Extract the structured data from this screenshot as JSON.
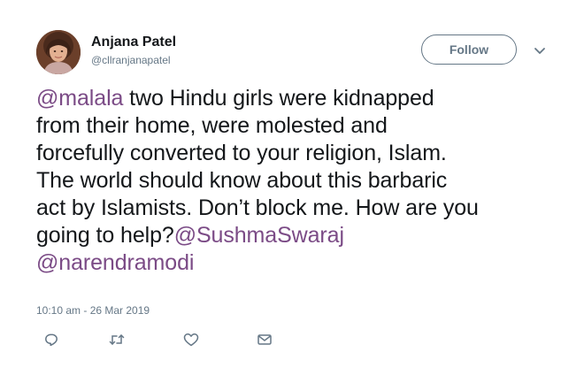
{
  "author": {
    "name": "Anjana Patel",
    "handle": "@cllranjanapatel"
  },
  "follow_label": "Follow",
  "tweet": {
    "segments": [
      {
        "text": "@malala",
        "type": "mention"
      },
      {
        "text": " two Hindu girls were kidnapped\nfrom their home, were molested and\nforcefully converted to your religion, Islam.\nThe world should know about this barbaric\nact by Islamists. Don’t block me. How are you\ngoing to help?",
        "type": "text"
      },
      {
        "text": "@SushmaSwaraj",
        "type": "mention"
      },
      {
        "text": "\n",
        "type": "text"
      },
      {
        "text": "@narendramodi",
        "type": "mention"
      }
    ]
  },
  "timestamp": "10:10 am - 26 Mar 2019",
  "icons": {
    "reply": "reply-icon",
    "retweet": "retweet-icon",
    "like": "heart-icon",
    "message": "envelope-icon",
    "menu": "chevron-down-icon"
  },
  "colors": {
    "text": "#14171a",
    "muted": "#657786",
    "mention": "#7b4b86"
  }
}
